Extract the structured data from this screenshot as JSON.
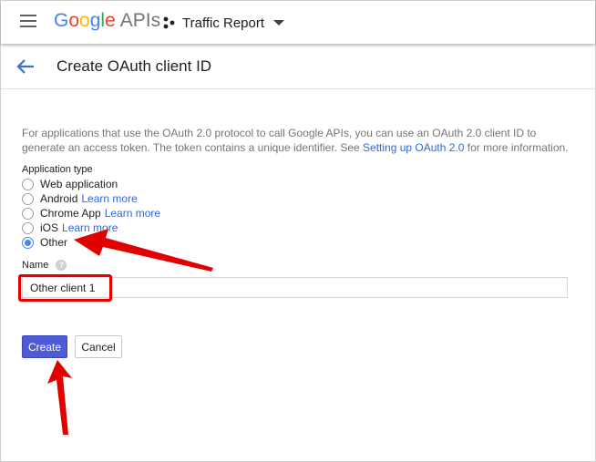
{
  "header": {
    "logo_google": "Google",
    "logo_apis": "APIs",
    "project_name": "Traffic Report"
  },
  "page": {
    "title": "Create OAuth client ID"
  },
  "intro": {
    "text_before": "For applications that use the OAuth 2.0 protocol to call Google APIs, you can use an OAuth 2.0 client ID to generate an access token. The token contains a unique identifier. See ",
    "link": "Setting up OAuth 2.0",
    "text_after": " for more information."
  },
  "application_type": {
    "label": "Application type",
    "options": [
      {
        "label": "Web application",
        "link": "",
        "checked": false
      },
      {
        "label": "Android",
        "link": "Learn more",
        "checked": false
      },
      {
        "label": "Chrome App",
        "link": "Learn more",
        "checked": false
      },
      {
        "label": "iOS",
        "link": "Learn more",
        "checked": false
      },
      {
        "label": "Other",
        "link": "",
        "checked": true
      }
    ]
  },
  "name": {
    "label": "Name",
    "help_glyph": "?",
    "value": "Other client 1"
  },
  "buttons": {
    "create": "Create",
    "cancel": "Cancel"
  },
  "colors": {
    "accent": "#4285f4",
    "create_button": "#4f5bd5",
    "annotation": "#e00000"
  }
}
